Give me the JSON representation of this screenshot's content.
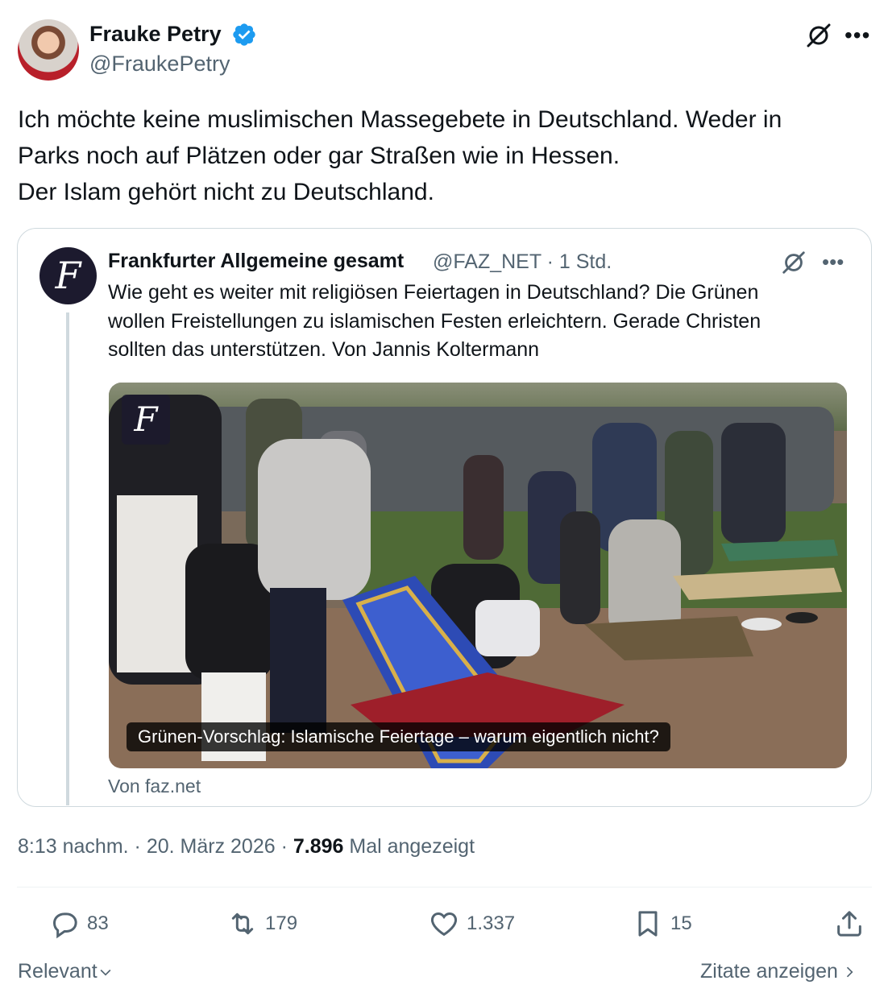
{
  "author": {
    "name": "Frauke Petry",
    "handle": "@FraukePetry"
  },
  "tweet": {
    "lines": [
      "Ich möchte keine muslimischen Massegebete in Deutschland. Weder in",
      "Parks noch auf Plätzen oder gar Straßen wie in Hessen.",
      "Der Islam gehört nicht zu Deutschland."
    ]
  },
  "quote": {
    "avatar_letter": "F",
    "name": "Frankfurter Allgemeine gesamt",
    "handle_time": "@FAZ_NET · 1 Std.",
    "lines": [
      "Wie geht es weiter mit religiösen Feiertagen in Deutschland? Die Grünen",
      "wollen Freistellungen zu islamischen Festen erleichtern. Gerade Christen",
      "sollten das unterstützen. Von Jannis Koltermann"
    ],
    "image_logo": "F",
    "image_caption": "Grünen-Vorschlag: Islamische Feiertage – warum eigentlich nicht?",
    "source": "Von faz.net"
  },
  "meta": {
    "time": "8:13 nachm.",
    "sep1": " · ",
    "date": "20. März 2026",
    "sep2": " · ",
    "views": "7.896",
    "views_label": " Mal angezeigt"
  },
  "actions": {
    "replies": "83",
    "reposts": "179",
    "likes": "1.337",
    "bookmarks": "15"
  },
  "footer": {
    "sort_label": "Relevant",
    "quotes_link": "Zitate anzeigen"
  },
  "colors": {
    "verified": "#1d9bf0",
    "muted": "#536471",
    "border": "#cfd9de"
  }
}
